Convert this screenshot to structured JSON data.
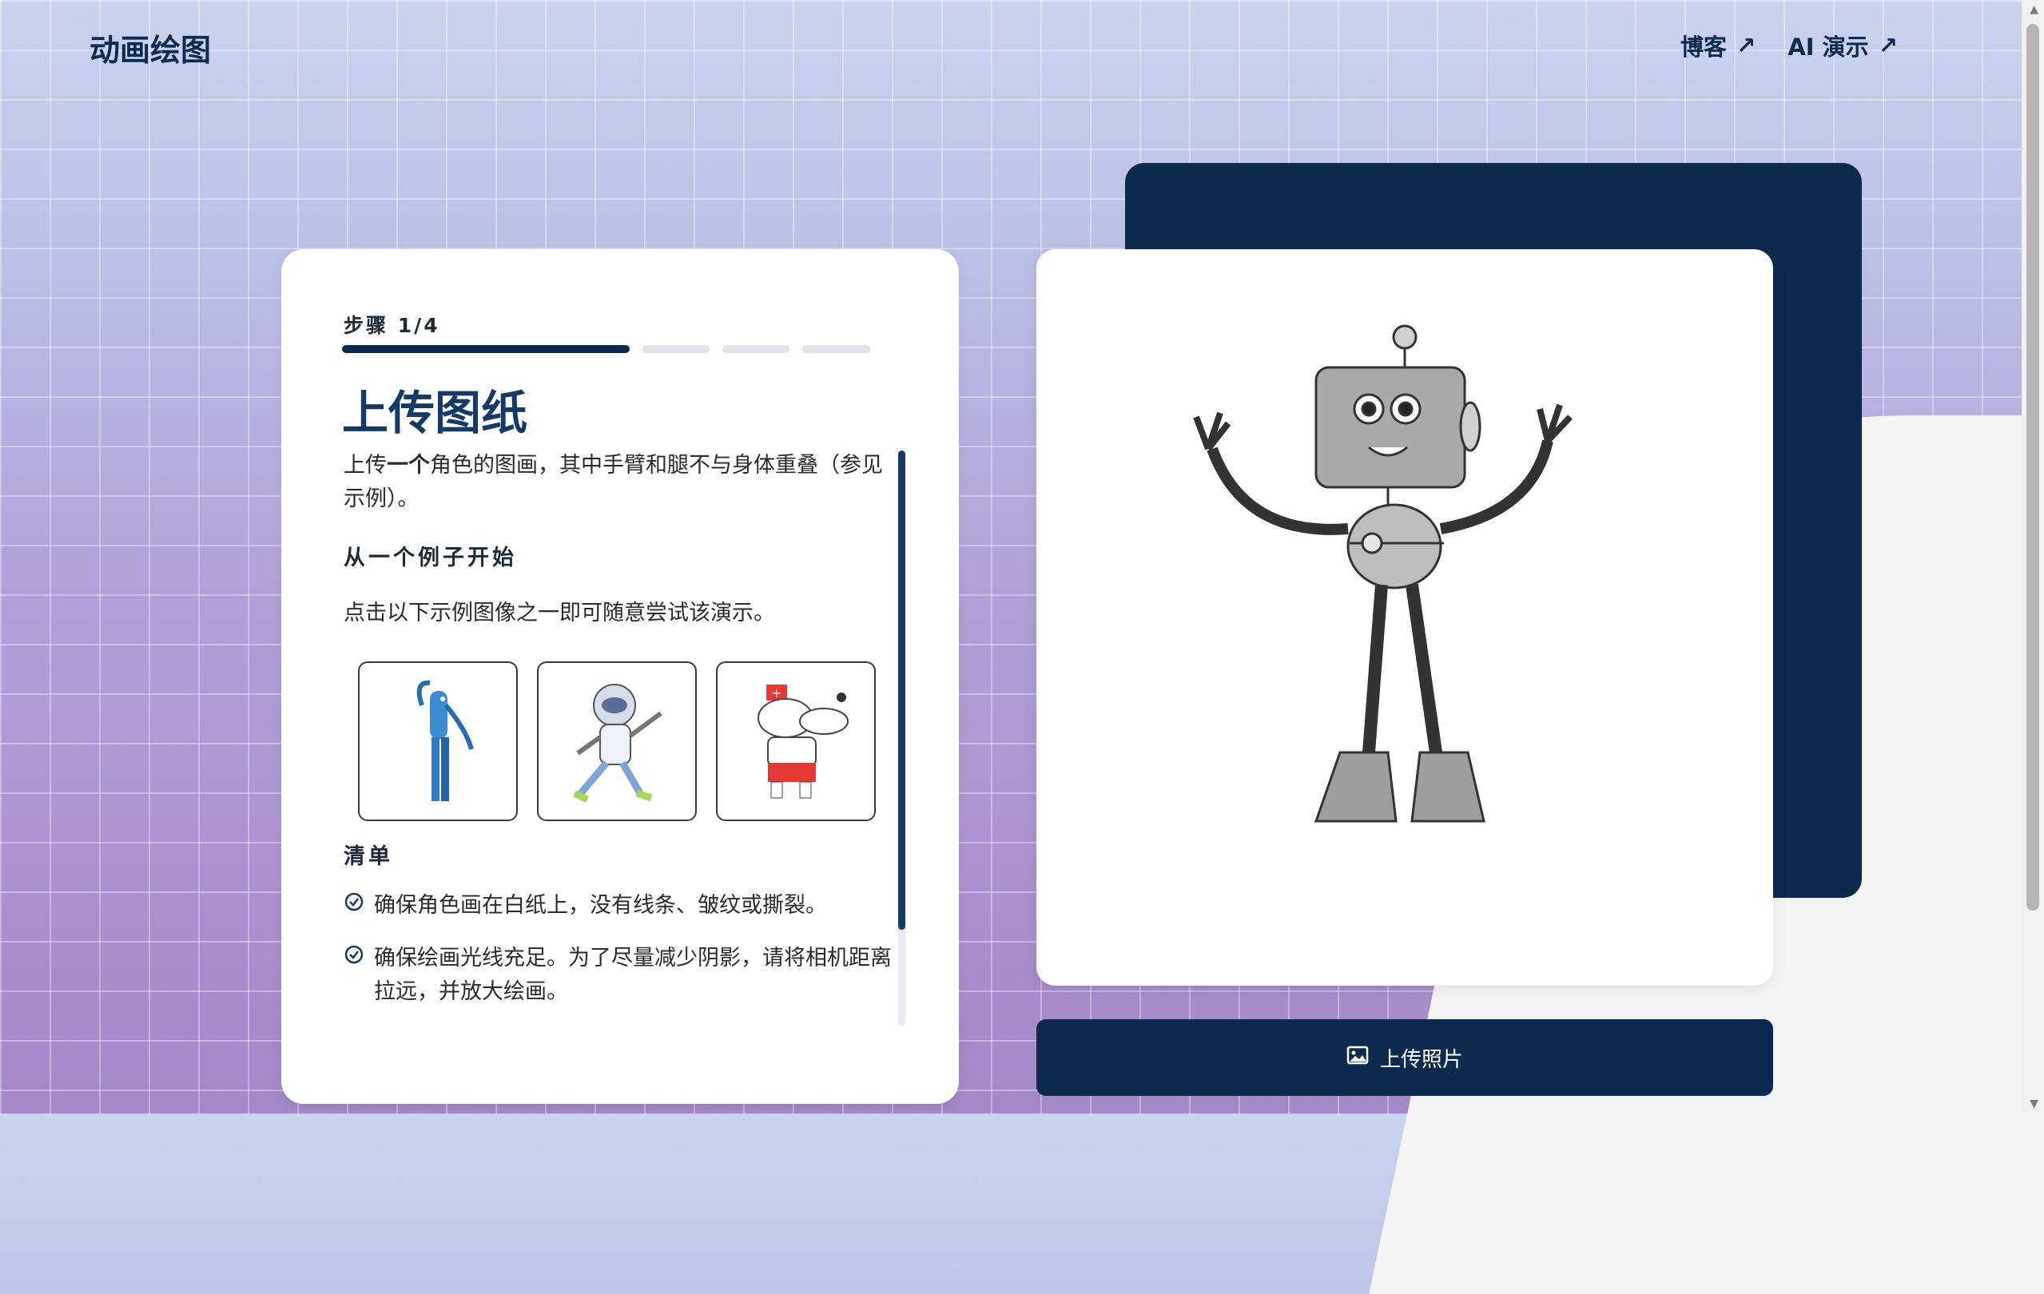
{
  "header": {
    "logo": "动画绘图",
    "nav": [
      {
        "label": "博客",
        "arrow": "↗"
      },
      {
        "label": "AI 演示",
        "arrow": "↗"
      }
    ]
  },
  "card": {
    "step_label": "步骤 1/4",
    "progress": {
      "current": 1,
      "total": 4
    },
    "title": "上传图纸",
    "desc_prefix": "上传",
    "desc_bold": "一个",
    "desc_suffix": "角色的图画，其中手臂和腿不与身体重叠（参见示例）。",
    "examples_heading": "从一个例子开始",
    "examples_sub": "点击以下示例图像之一即可随意尝试该演示。",
    "examples": [
      {
        "icon": "blue-creature-drawing"
      },
      {
        "icon": "astronaut-drawing"
      },
      {
        "icon": "dog-nurse-drawing"
      }
    ],
    "checklist_title": "清单",
    "checklist": [
      "确保角色画在白纸上，没有线条、皱纹或撕裂。",
      "确保绘画光线充足。为了尽量减少阴影，请将相机距离拉远，并放大绘画。"
    ]
  },
  "preview": {
    "icon": "robot-drawing"
  },
  "upload_button": {
    "label": "上传照片",
    "icon": "image-icon"
  },
  "colors": {
    "navy": "#0f2a50",
    "title": "#163a68"
  }
}
